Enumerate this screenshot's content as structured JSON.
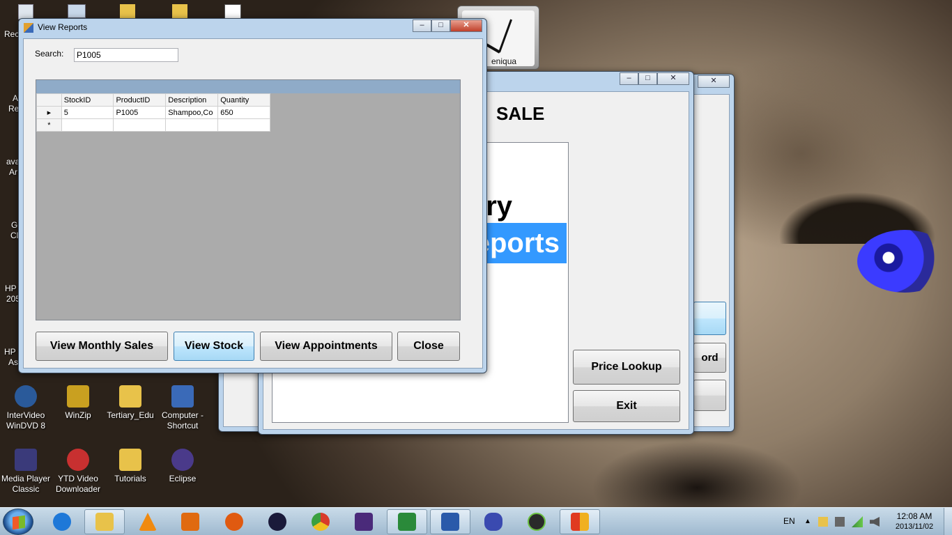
{
  "desktop": {
    "edge_labels": [
      "Rec",
      "A",
      "Re",
      "ava",
      "Ar",
      "G",
      "Cl",
      "HP",
      "205",
      "HP",
      "As"
    ],
    "icons": [
      {
        "label": "InterVideo\nWinDVD 8",
        "name": "intervideo-windvd-icon",
        "color": "#2a5a9a"
      },
      {
        "label": "WinZip",
        "name": "winzip-icon",
        "color": "#c9a020"
      },
      {
        "label": "Tertiary_Edu",
        "name": "folder-tertiary-edu-icon",
        "color": "#e8c24a"
      },
      {
        "label": "Computer -\nShortcut",
        "name": "computer-shortcut-icon",
        "color": "#3a6ab8"
      },
      {
        "label": "Media Player\nClassic",
        "name": "media-player-classic-icon",
        "color": "#3a3a7a"
      },
      {
        "label": "YTD Video\nDownloader",
        "name": "ytd-video-downloader-icon",
        "color": "#c83030"
      },
      {
        "label": "Tutorials",
        "name": "folder-tutorials-icon",
        "color": "#e8c24a"
      },
      {
        "label": "Eclipse",
        "name": "eclipse-icon",
        "color": "#4a3a8a"
      }
    ],
    "clock_label": "eniqua"
  },
  "main_window": {
    "heading": "SALE",
    "list_items": [
      {
        "text": "ry",
        "selected": false
      },
      {
        "text": "eports",
        "selected": true
      }
    ],
    "buttons": {
      "price_lookup": "Price Lookup",
      "exit": "Exit"
    }
  },
  "back_window": {
    "partial_button": "ord"
  },
  "reports_window": {
    "title": "View Reports",
    "search_label": "Search:",
    "search_value": "P1005",
    "grid": {
      "columns": [
        "StockID",
        "ProductID",
        "Description",
        "Quantity"
      ],
      "rows": [
        [
          "5",
          "P1005",
          "Shampoo,Co",
          "650"
        ]
      ],
      "new_row_marker": "*"
    },
    "buttons": {
      "monthly_sales": "View Monthly Sales",
      "stock": "View Stock",
      "appointments": "View Appointments",
      "close": "Close"
    }
  },
  "taskbar": {
    "apps": [
      {
        "name": "internet-explorer-icon",
        "color": "#1e78d8"
      },
      {
        "name": "windows-explorer-icon",
        "color": "#e8c24a",
        "active": true
      },
      {
        "name": "vlc-icon",
        "color": "#f08a10"
      },
      {
        "name": "media-center-icon",
        "color": "#e06a10"
      },
      {
        "name": "firefox-icon",
        "color": "#e05a10"
      },
      {
        "name": "hp-icon",
        "color": "#1a1a3a"
      },
      {
        "name": "chrome-icon",
        "color": "#3aa040"
      },
      {
        "name": "java-ee-ide-icon",
        "color": "#4a2a7a"
      },
      {
        "name": "download-icon",
        "color": "#2a8a3a",
        "active": true
      },
      {
        "name": "word-icon",
        "color": "#2a5aaa",
        "active": true
      },
      {
        "name": "visual-studio-icon",
        "color": "#3a4ab0"
      },
      {
        "name": "android-icon",
        "color": "#2a2a2a"
      },
      {
        "name": "app-window-icon",
        "color": "#e03a20",
        "active": true
      }
    ],
    "language": "EN",
    "time": "12:08 AM",
    "date": "2013/11/02"
  }
}
